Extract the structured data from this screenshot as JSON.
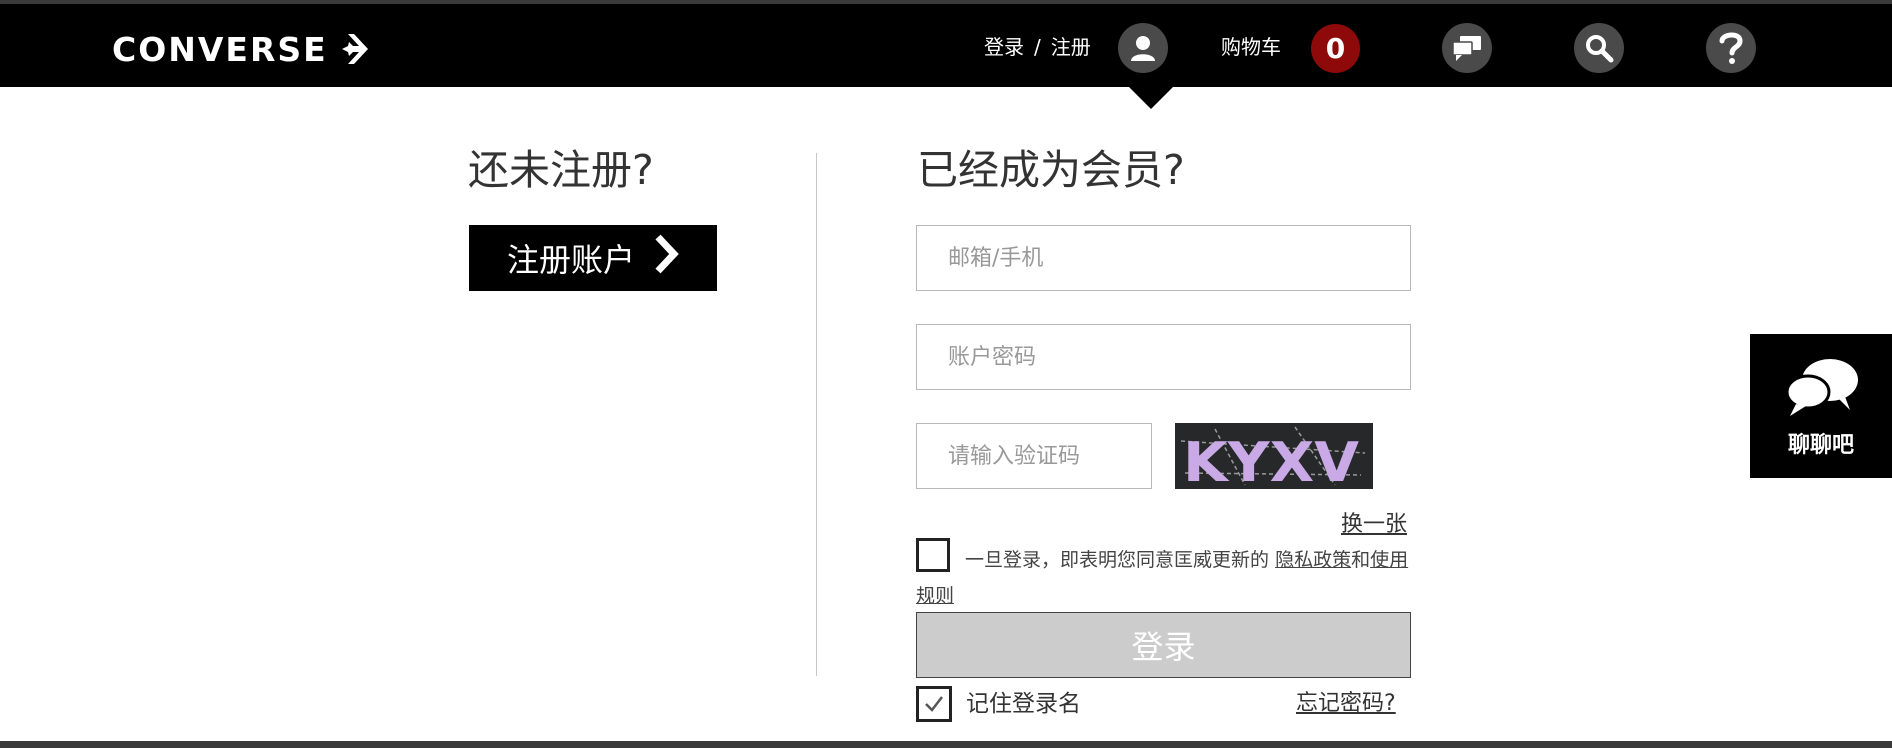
{
  "header": {
    "logo_text": "CONVERSE",
    "login_label": "登录",
    "separator": "/",
    "register_label": "注册",
    "cart_label": "购物车",
    "cart_count": "0",
    "icons": [
      "user-icon",
      "chat-bubbles-icon",
      "search-icon",
      "help-icon"
    ]
  },
  "left": {
    "title": "还未注册?",
    "register_button": "注册账户"
  },
  "right": {
    "title": "已经成为会员?",
    "email_placeholder": "邮箱/手机",
    "password_placeholder": "账户密码",
    "captcha_placeholder": "请输入验证码",
    "captcha_text": "KYXV",
    "refresh_captcha": "换一张",
    "agreement_prefix": "一旦登录，即表明您同意匡威更新的",
    "privacy_link": "隐私政策",
    "and_text": "和",
    "terms_link": "使用规则",
    "login_button": "登录",
    "remember_label": "记住登录名",
    "remember_checked": true,
    "forgot_link": "忘记密码?"
  },
  "chat_widget": {
    "label": "聊聊吧"
  },
  "colors": {
    "header_bg": "#000000",
    "cart_badge": "#8e0a0a",
    "icon_circle": "#4a4a4a",
    "disabled_button": "#cccccc"
  }
}
